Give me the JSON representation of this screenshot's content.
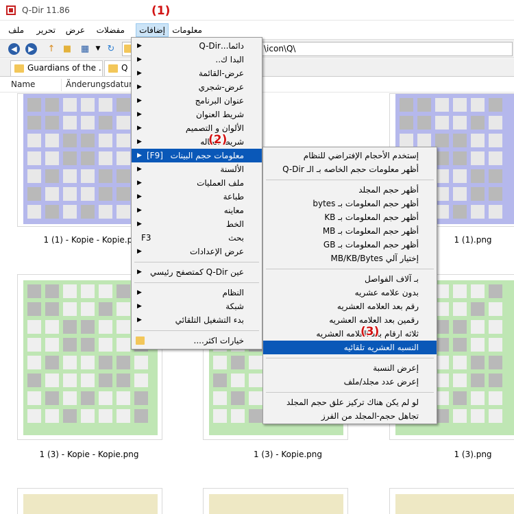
{
  "window": {
    "title": "Q-Dir 11.86"
  },
  "menubar": {
    "items": [
      {
        "label": "معلومات"
      },
      {
        "label": "إضافات"
      },
      {
        "label": "مفضلات"
      },
      {
        "label": "عرض"
      },
      {
        "label": "تحرير"
      },
      {
        "label": "ملف"
      }
    ]
  },
  "address": {
    "text": "\\icon\\Q\\"
  },
  "tabs": [
    {
      "label": "Guardians of the ..."
    },
    {
      "label": "Q"
    }
  ],
  "columns": {
    "name": "Name",
    "date": "Änderungsdatum"
  },
  "files": [
    {
      "caption": "1 (1) - Kopie - Kopie.png"
    },
    {
      "caption": "1 (1).png"
    },
    {
      "caption": "1 (3) - Kopie - Kopie.png"
    },
    {
      "caption": "1 (3) - Kopie.png"
    },
    {
      "caption": "1 (3).png"
    }
  ],
  "callouts": {
    "one": "(1)",
    "two": "(2)",
    "three": "(3)"
  },
  "main_menu": {
    "items": [
      {
        "label": "دائما...Q-Dir"
      },
      {
        "label": "البدا ك.."
      },
      {
        "label": "عرض-القائمة"
      },
      {
        "label": "عرض-شجري"
      },
      {
        "label": "عنوان البرنامج"
      },
      {
        "label": "شريط العنوان"
      },
      {
        "label": "الألوان و التصميم"
      },
      {
        "label": "شريط الحاله"
      },
      {
        "label": "معلومات حجم البينات",
        "shortcut": "[F9]"
      },
      {
        "label": "الألسنة"
      },
      {
        "label": "ملف العمليات"
      },
      {
        "label": "طباعة"
      },
      {
        "label": "معاينه"
      },
      {
        "label": "الخط"
      },
      {
        "label": "بحث",
        "shortcut": "F3"
      },
      {
        "label": "عرض الإعدادات"
      },
      {
        "label": "عين Q-Dir كمتصفح رئيسي"
      },
      {
        "label": "النظام"
      },
      {
        "label": "شبكة"
      },
      {
        "label": "بدء التشغيل التلقائي"
      },
      {
        "label": "خيارات اكثر...."
      }
    ]
  },
  "sub_menu": {
    "items": [
      {
        "label": "إستخدم الأحجام الإفتراضي للنظام"
      },
      {
        "label": "أظهر معلومات حجم الخاصه بـ الـ Q-Dir"
      },
      {
        "label": "أظهر حجم المجلد"
      },
      {
        "label": "أظهر حجم المعلومات بـ bytes"
      },
      {
        "label": "أظهر حجم المعلومات بـ KB"
      },
      {
        "label": "أظهر حجم المعلومات بـ MB"
      },
      {
        "label": "أظهر حجم المعلومات بـ GB"
      },
      {
        "label": "إختيار آلي MB/KB/Bytes"
      },
      {
        "label": "بـ آلاف الفواصل"
      },
      {
        "label": "بدون علامه عشريه"
      },
      {
        "label": "رقم بعد العلامه العشريه"
      },
      {
        "label": "رقمين بعد العلامه العشريه"
      },
      {
        "label": "ثلاثه ارقام بعد العلامه العشريه"
      },
      {
        "label": "النسبه العشريه تلقائيه"
      },
      {
        "label": "إعرض النسبة"
      },
      {
        "label": "إعرض عدد مجلد/ملف"
      },
      {
        "label": "لو لم يكن هناك تركيز علق حجم المجلد"
      },
      {
        "label": "تجاهل حجم-المجلد من الفرز"
      }
    ]
  },
  "colors": {
    "blue_tile": "#b5b8ec",
    "green_tile": "#bfe6b4",
    "yellow_tile": "#eee8c4",
    "highlight": "#0a58b8",
    "callout": "#d21414"
  }
}
